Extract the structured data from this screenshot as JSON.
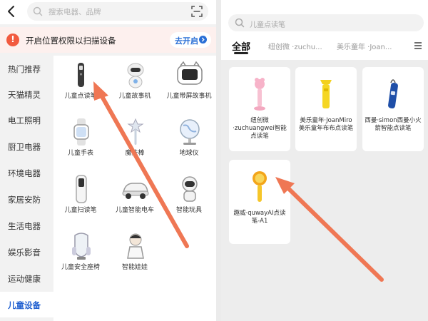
{
  "left": {
    "search_placeholder": "搜索电器、品牌",
    "banner": {
      "text": "开启位置权限以扫描设备",
      "button": "去开启"
    },
    "categories": [
      {
        "label": "热门推荐"
      },
      {
        "label": "天猫精灵"
      },
      {
        "label": "电工照明"
      },
      {
        "label": "厨卫电器"
      },
      {
        "label": "环境电器"
      },
      {
        "label": "家居安防"
      },
      {
        "label": "生活电器"
      },
      {
        "label": "娱乐影音"
      },
      {
        "label": "运动健康"
      },
      {
        "label": "儿童设备"
      }
    ],
    "active_category": "儿童设备",
    "products": [
      {
        "label": "儿童点读笔"
      },
      {
        "label": "儿童故事机"
      },
      {
        "label": "儿童带屏故事机"
      },
      {
        "label": "儿童手表"
      },
      {
        "label": "魔法棒"
      },
      {
        "label": "地球仪"
      },
      {
        "label": "儿童扫读笔"
      },
      {
        "label": "儿童智能电车"
      },
      {
        "label": "智能玩具"
      },
      {
        "label": "儿童安全座椅"
      },
      {
        "label": "智能娃娃"
      }
    ]
  },
  "right": {
    "search_placeholder": "儿童点读笔",
    "tabs": [
      {
        "label": "全部"
      },
      {
        "label": "纽创微 ·zuchu..."
      },
      {
        "label": "美乐童年 ·Joan..."
      }
    ],
    "active_tab": "全部",
    "products": [
      {
        "label": "纽创微·zuchuangwei智能点读笔"
      },
      {
        "label": "美乐童年·JoanMiro美乐童年布布点读笔"
      },
      {
        "label": "西曼·simon西曼小火箭智能点读笔"
      },
      {
        "label": "趣威·quwayAI点读笔-A1"
      }
    ]
  },
  "colors": {
    "accent_blue": "#1f5fd0",
    "annotation_arrow": "#ef7754",
    "warning_red": "#f25a3f"
  }
}
